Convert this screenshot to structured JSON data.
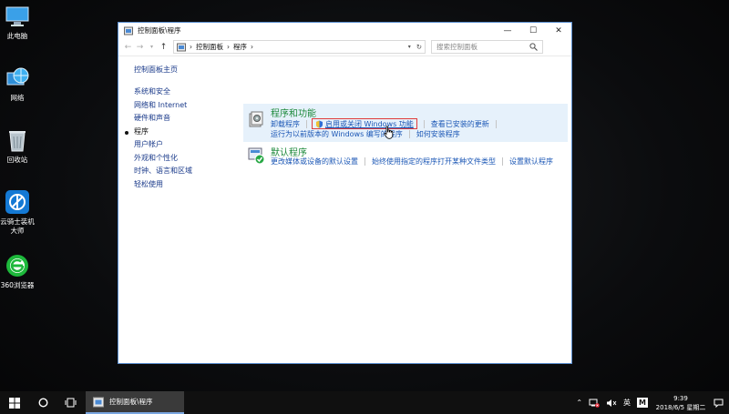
{
  "desktop": {
    "icons": [
      {
        "label": "此电脑"
      },
      {
        "label": "网络"
      },
      {
        "label": "回收站"
      },
      {
        "label": "云骑士装机\n大师"
      },
      {
        "label": "360浏览器"
      }
    ]
  },
  "window": {
    "title": "控制面板\\程序",
    "buttons": {
      "minimize": "—",
      "maximize": "☐",
      "close": "✕"
    },
    "address": {
      "segments": [
        "控制面板",
        "程序"
      ],
      "search_placeholder": "搜索控制面板"
    },
    "nav": {
      "home": "控制面板主页",
      "items": [
        "系统和安全",
        "网络和 Internet",
        "硬件和声音",
        "程序",
        "用户帐户",
        "外观和个性化",
        "时钟、语言和区域",
        "轻松使用"
      ],
      "current": "程序"
    },
    "sections": {
      "programs": {
        "title": "程序和功能",
        "links": {
          "uninstall": "卸载程序",
          "windows_features": "启用或关闭 Windows 功能",
          "installed_updates": "查看已安装的更新",
          "compat": "运行为以前版本的 Windows 编写的程序",
          "how_to_install": "如何安装程序"
        }
      },
      "defaults": {
        "title": "默认程序",
        "links": {
          "change_media": "更改媒体或设备的默认设置",
          "file_type": "始终使用指定的程序打开某种文件类型",
          "set_default": "设置默认程序"
        }
      }
    }
  },
  "taskbar": {
    "app_label": "控制面板\\程序",
    "ime": "英",
    "time": "9:39",
    "date": "2018/6/5 星期二"
  }
}
